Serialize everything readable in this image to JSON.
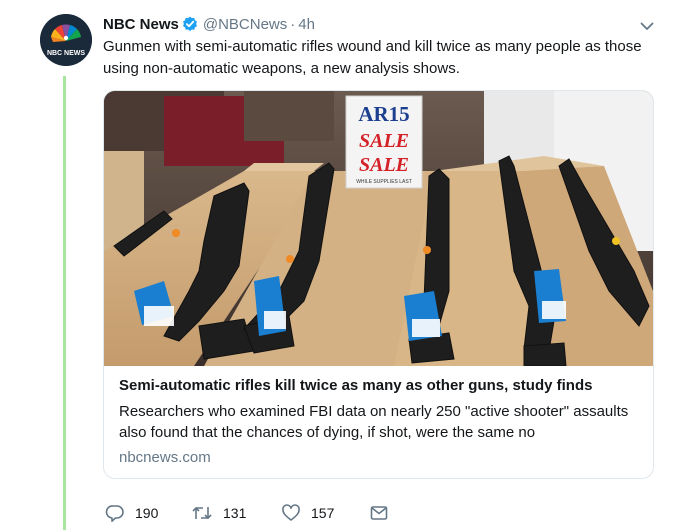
{
  "tweet": {
    "avatar_label": "NBC NEWS",
    "display_name": "NBC News",
    "handle": "@NBCNews",
    "separator": "·",
    "time": "4h",
    "text": "Gunmen with semi-automatic rifles wound and kill twice as many people as those using non-automatic weapons, a new analysis shows."
  },
  "card": {
    "image_sign": {
      "line1": "AR15",
      "line2": "SALE",
      "line3": "SALE",
      "line4": "WHILE SUPPLIES LAST"
    },
    "title": "Semi-automatic rifles kill twice as many as other guns, study finds",
    "description": "Researchers who examined FBI data on nearly 250 \"active shooter\" assaults also found that the chances of dying, if shot, were the same no",
    "domain": "nbcnews.com"
  },
  "actions": {
    "reply_count": "190",
    "retweet_count": "131",
    "like_count": "157"
  },
  "colors": {
    "verified_blue": "#1da1f2",
    "thread_line": "#a8e6a0",
    "secondary_text": "#657786"
  },
  "icons": [
    "nbc-peacock-icon",
    "verified-icon",
    "chevron-down-icon",
    "reply-icon",
    "retweet-icon",
    "like-icon",
    "direct-message-icon"
  ]
}
